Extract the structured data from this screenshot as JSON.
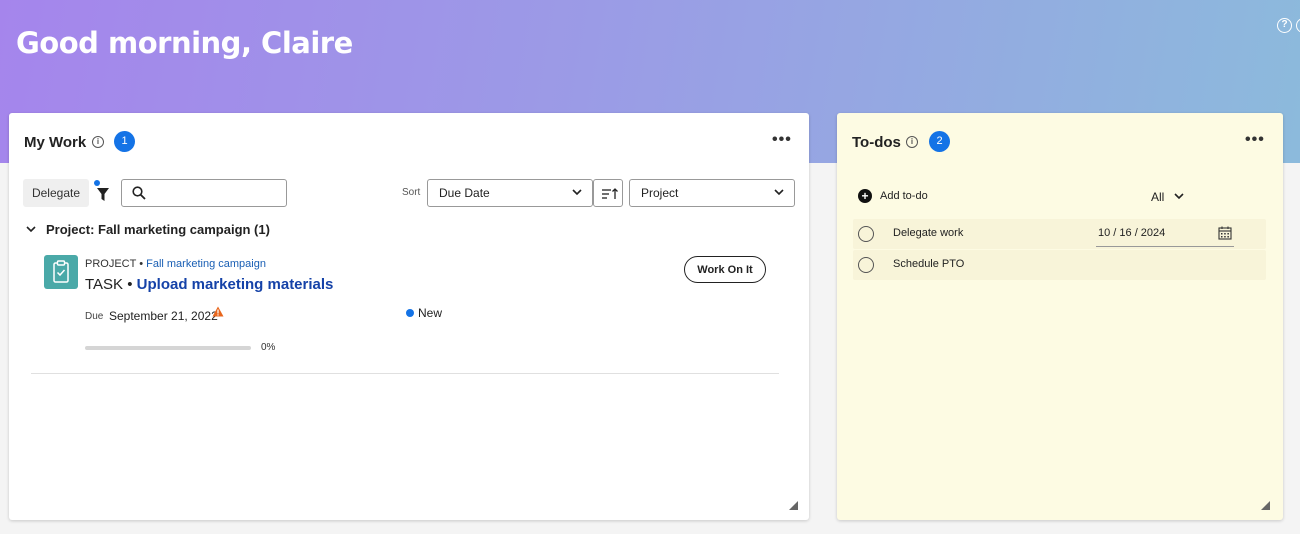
{
  "header": {
    "greeting": "Good morning, Claire",
    "help_icon": "help-icon"
  },
  "my_work": {
    "title": "My Work",
    "count": "1",
    "more_icon": "•••",
    "delegate_label": "Delegate",
    "search_placeholder": "",
    "sort_label": "Sort",
    "sort_value": "Due Date",
    "group_value": "Project",
    "group_header": "Project: Fall marketing campaign (1)",
    "task": {
      "project_prefix": "PROJECT • ",
      "project_name": "Fall marketing campaign",
      "type_prefix": "TASK • ",
      "name": "Upload marketing materials",
      "due_label": "Due",
      "due_date": "September 21, 2022",
      "status": "New",
      "progress_text": "0%",
      "progress": 0,
      "action_label": "Work On It"
    }
  },
  "todos": {
    "title": "To-dos",
    "count": "2",
    "more_icon": "•••",
    "add_label": "Add to-do",
    "filter_value": "All",
    "items": [
      {
        "label": "Delegate work",
        "date": "10 / 16 / 2024"
      },
      {
        "label": "Schedule PTO",
        "date": ""
      }
    ]
  },
  "colors": {
    "accent": "#1473e6",
    "todo_bg": "#fdfbe3",
    "avatar": "#4aa9a8",
    "warning": "#e34850"
  }
}
